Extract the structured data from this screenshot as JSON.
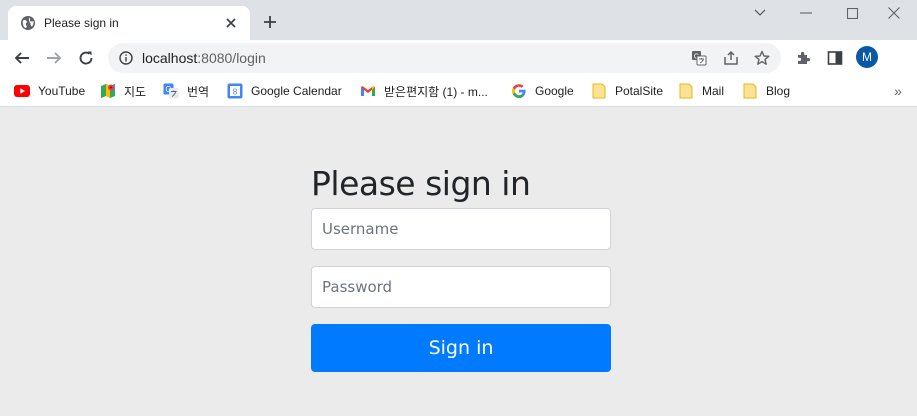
{
  "browser": {
    "tab": {
      "title": "Please sign in"
    },
    "address": {
      "host": "localhost",
      "rest": ":8080/login"
    },
    "profile_initial": "M",
    "bookmarks": [
      {
        "label": "YouTube",
        "icon": "youtube-icon"
      },
      {
        "label": "지도",
        "icon": "maps-icon"
      },
      {
        "label": "번역",
        "icon": "translate-icon"
      },
      {
        "label": "Google Calendar",
        "icon": "calendar-icon"
      },
      {
        "label": "받은편지함 (1) - m...",
        "icon": "gmail-icon"
      },
      {
        "label": "Google",
        "icon": "google-icon"
      },
      {
        "label": "PotalSite",
        "icon": "folder-icon"
      },
      {
        "label": "Mail",
        "icon": "folder-icon"
      },
      {
        "label": "Blog",
        "icon": "folder-icon"
      }
    ],
    "bookmarks_more": "»"
  },
  "login": {
    "heading": "Please sign in",
    "username_placeholder": "Username",
    "password_placeholder": "Password",
    "submit_label": "Sign in"
  },
  "colors": {
    "primary": "#007bff",
    "page_bg": "#ebebeb",
    "tabstrip_bg": "#dee1e6",
    "avatar_bg": "#0b57a8"
  }
}
